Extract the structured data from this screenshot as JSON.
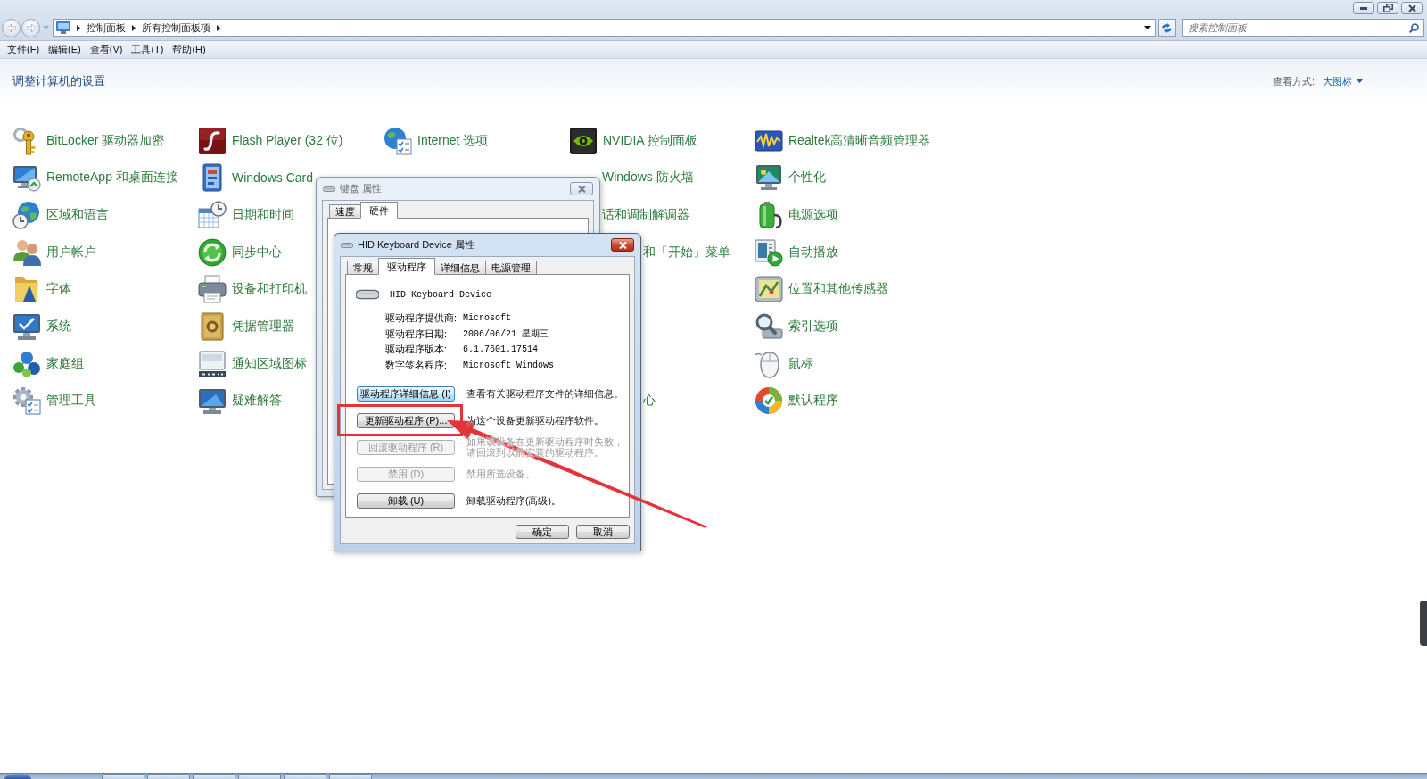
{
  "address_bar": {
    "breadcrumbs": [
      "控制面板",
      "所有控制面板项"
    ]
  },
  "search": {
    "placeholder": "搜索控制面板"
  },
  "menu": [
    "文件(F)",
    "编辑(E)",
    "查看(V)",
    "工具(T)",
    "帮助(H)"
  ],
  "header": {
    "title": "调整计算机的设置",
    "view_label": "查看方式:",
    "view_value": "大图标"
  },
  "rows": [
    [
      {
        "label": "BitLocker 驱动器加密",
        "kind": "full"
      },
      {
        "label": "Flash Player (32 位)",
        "kind": "full"
      },
      {
        "label": "Internet 选项",
        "kind": "full"
      },
      {
        "label": "NVIDIA 控制面板",
        "kind": "full"
      },
      {
        "label": "Realtek高清晰音频管理器",
        "kind": "full"
      }
    ],
    [
      {
        "label": "RemoteApp 和桌面连接",
        "kind": "full"
      },
      {
        "label": "Windows Card",
        "kind": "full"
      },
      {
        "label": "Windows 防火墙",
        "kind": "cut"
      },
      {
        "label": "个性化",
        "kind": "full"
      }
    ],
    [
      {
        "label": "区域和语言",
        "kind": "full"
      },
      {
        "label": "日期和时间",
        "kind": "full"
      },
      {
        "label": "话和调制解调器",
        "kind": "cut"
      },
      {
        "label": "电源选项",
        "kind": "full"
      }
    ],
    [
      {
        "label": "用户帐户",
        "kind": "full"
      },
      {
        "label": "同步中心",
        "kind": "full"
      },
      {
        "label": "和「开始」菜单",
        "kind": "cut"
      },
      {
        "label": "自动播放",
        "kind": "full"
      }
    ],
    [
      {
        "label": "字体",
        "kind": "full"
      },
      {
        "label": "设备和打印机",
        "kind": "full"
      },
      {
        "label": "位置和其他传感器",
        "kind": "full"
      }
    ],
    [
      {
        "label": "系统",
        "kind": "full"
      },
      {
        "label": "凭据管理器",
        "kind": "full"
      },
      {
        "label": "索引选项",
        "kind": "full"
      }
    ],
    [
      {
        "label": "家庭组",
        "kind": "full"
      },
      {
        "label": "通知区域图标",
        "kind": "full"
      },
      {
        "label": "鼠标",
        "kind": "full"
      }
    ],
    [
      {
        "label": "管理工具",
        "kind": "full"
      },
      {
        "label": "疑难解答",
        "kind": "full"
      },
      {
        "label": "心",
        "kind": "cut"
      },
      {
        "label": "默认程序",
        "kind": "full"
      }
    ]
  ],
  "dialogs": [
    {
      "title": "键盘 属性",
      "active": false,
      "kind": "hardware",
      "tabs": [
        {
          "label": "速度",
          "selected": false
        },
        {
          "label": "硬件",
          "selected": true
        }
      ]
    },
    {
      "title": "HID Keyboard Device 属性",
      "active": true,
      "kind": "driver",
      "tabs": [
        {
          "label": "常规",
          "selected": false
        },
        {
          "label": "驱动程序",
          "selected": true
        },
        {
          "label": "详细信息",
          "selected": false
        },
        {
          "label": "电源管理",
          "selected": false
        }
      ],
      "device": "HID Keyboard Device",
      "properties": [
        {
          "label": "驱动程序提供商:",
          "value": "Microsoft"
        },
        {
          "label": "驱动程序日期:",
          "value": "2006/06/21 星期三"
        },
        {
          "label": "驱动程序版本:",
          "value": "6.1.7601.17514"
        },
        {
          "label": "数字签名程序:",
          "value": "Microsoft Windows"
        }
      ],
      "actions": [
        {
          "label": "驱动程序详细信息 (I)",
          "description": "查看有关驱动程序文件的详细信息。",
          "disabled": false,
          "focused": true
        },
        {
          "label": "更新驱动程序 (P)...",
          "description": "为这个设备更新驱动程序软件。",
          "disabled": false,
          "focused": false
        },
        {
          "label": "回滚驱动程序 (R)",
          "description": "如果该设备在更新驱动程序时失败，请回滚到以前安装的驱动程序。",
          "disabled": true,
          "focused": false
        },
        {
          "label": "禁用 (D)",
          "description": "禁用所选设备。",
          "disabled": true,
          "focused": false
        },
        {
          "label": "卸载 (U)",
          "description": "卸载驱动程序(高级)。",
          "disabled": false,
          "focused": false
        }
      ],
      "buttons": [
        "确定",
        "取消"
      ]
    }
  ]
}
